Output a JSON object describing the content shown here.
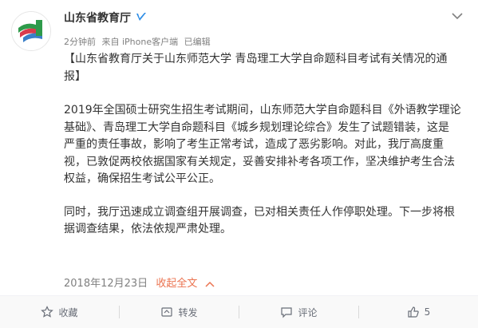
{
  "post": {
    "user_name": "山东省教育厅",
    "meta": {
      "time": "2分钟前",
      "source": "来自 iPhone客户端",
      "edited": "已编辑"
    },
    "title_line1": "【山东省教育厅关于山东师范大学 青岛理工大学自命题科目考试有关情况的通",
    "title_line2": "报】",
    "para1_lines": [
      "2019年全国硕士研究生招生考试期间，山东师范大学自命题科目《外语教学理论",
      "基础》、青岛理工大学自命题科目《城乡规划理论综合》发生了试题错装，这是",
      "严重的责任事故，影响了考生正常考试，造成了恶劣影响。对此，我厅高度重",
      "视，已敦促两校依据国家有关规定，妥善安排补考各项工作，坚决维护考生合法",
      "权益，确保招生考试公平公正。"
    ],
    "para2_lines": [
      "同时，我厅迅速成立调查组开展调查，已对相关责任人作停职处理。下一步将根",
      "据调查结果，依法依规严肃处理。"
    ],
    "date": "2018年12月23日",
    "collapse_label": "收起全文"
  },
  "actions": {
    "favorite": "收藏",
    "repost": "转发",
    "comment": "评论",
    "like_count": "5"
  },
  "colors": {
    "link_orange": "#eb7350",
    "verified_blue": "#2d8de6",
    "meta_gray": "#808080"
  },
  "icons": {
    "verified": "verified-badge-icon",
    "more": "chevron-down-icon",
    "favorite": "star-icon",
    "repost": "repost-icon",
    "comment": "comment-icon",
    "like": "thumbs-up-icon",
    "collapse": "chevron-up-icon"
  }
}
